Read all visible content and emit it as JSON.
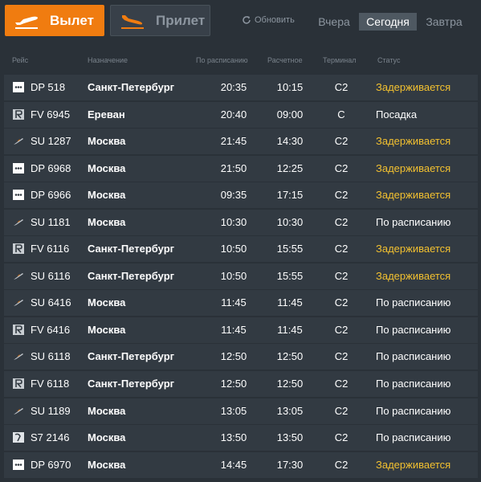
{
  "tabs": {
    "departures": "Вылет",
    "arrivals": "Прилет"
  },
  "refresh_label": "Обновить",
  "days": {
    "yesterday": "Вчера",
    "today": "Сегодня",
    "tomorrow": "Завтра"
  },
  "columns": {
    "flight": "Рейс",
    "destination": "Назначение",
    "scheduled": "По расписанию",
    "estimated": "Расчетное",
    "terminal": "Терминал",
    "status": "Статус"
  },
  "colors": {
    "accent": "#f07c10",
    "delayed": "#f2c030",
    "background": "#2a3138",
    "row": "#323a42"
  },
  "flights": [
    {
      "airline_icon": "dots-logo",
      "flight": "DP 518",
      "destination": "Санкт-Петербург",
      "scheduled": "20:35",
      "estimated": "10:15",
      "terminal": "C2",
      "status": "Задерживается",
      "delayed": true
    },
    {
      "airline_icon": "r-logo",
      "flight": "FV 6945",
      "destination": "Ереван",
      "scheduled": "20:40",
      "estimated": "09:00",
      "terminal": "C",
      "status": "Посадка",
      "delayed": false
    },
    {
      "airline_icon": "wing-logo",
      "flight": "SU 1287",
      "destination": "Москва",
      "scheduled": "21:45",
      "estimated": "14:30",
      "terminal": "C2",
      "status": "Задерживается",
      "delayed": true
    },
    {
      "airline_icon": "dots-logo",
      "flight": "DP 6968",
      "destination": "Москва",
      "scheduled": "21:50",
      "estimated": "12:25",
      "terminal": "C2",
      "status": "Задерживается",
      "delayed": true
    },
    {
      "airline_icon": "dots-logo",
      "flight": "DP 6966",
      "destination": "Москва",
      "scheduled": "09:35",
      "estimated": "17:15",
      "terminal": "C2",
      "status": "Задерживается",
      "delayed": true
    },
    {
      "airline_icon": "wing-logo",
      "flight": "SU 1181",
      "destination": "Москва",
      "scheduled": "10:30",
      "estimated": "10:30",
      "terminal": "C2",
      "status": "По расписанию",
      "delayed": false
    },
    {
      "airline_icon": "r-logo",
      "flight": "FV 6116",
      "destination": "Санкт-Петербург",
      "scheduled": "10:50",
      "estimated": "15:55",
      "terminal": "C2",
      "status": "Задерживается",
      "delayed": true
    },
    {
      "airline_icon": "wing-logo",
      "flight": "SU 6116",
      "destination": "Санкт-Петербург",
      "scheduled": "10:50",
      "estimated": "15:55",
      "terminal": "C2",
      "status": "Задерживается",
      "delayed": true
    },
    {
      "airline_icon": "wing-logo",
      "flight": "SU 6416",
      "destination": "Москва",
      "scheduled": "11:45",
      "estimated": "11:45",
      "terminal": "C2",
      "status": "По расписанию",
      "delayed": false
    },
    {
      "airline_icon": "r-logo",
      "flight": "FV 6416",
      "destination": "Москва",
      "scheduled": "11:45",
      "estimated": "11:45",
      "terminal": "C2",
      "status": "По расписанию",
      "delayed": false
    },
    {
      "airline_icon": "wing-logo",
      "flight": "SU 6118",
      "destination": "Санкт-Петербург",
      "scheduled": "12:50",
      "estimated": "12:50",
      "terminal": "C2",
      "status": "По расписанию",
      "delayed": false
    },
    {
      "airline_icon": "r-logo",
      "flight": "FV 6118",
      "destination": "Санкт-Петербург",
      "scheduled": "12:50",
      "estimated": "12:50",
      "terminal": "C2",
      "status": "По расписанию",
      "delayed": false
    },
    {
      "airline_icon": "wing-logo",
      "flight": "SU 1189",
      "destination": "Москва",
      "scheduled": "13:05",
      "estimated": "13:05",
      "terminal": "C2",
      "status": "По расписанию",
      "delayed": false
    },
    {
      "airline_icon": "s7-logo",
      "flight": "S7 2146",
      "destination": "Москва",
      "scheduled": "13:50",
      "estimated": "13:50",
      "terminal": "C2",
      "status": "По расписанию",
      "delayed": false
    },
    {
      "airline_icon": "dots-logo",
      "flight": "DP 6970",
      "destination": "Москва",
      "scheduled": "14:45",
      "estimated": "17:30",
      "terminal": "C2",
      "status": "Задерживается",
      "delayed": true
    }
  ]
}
